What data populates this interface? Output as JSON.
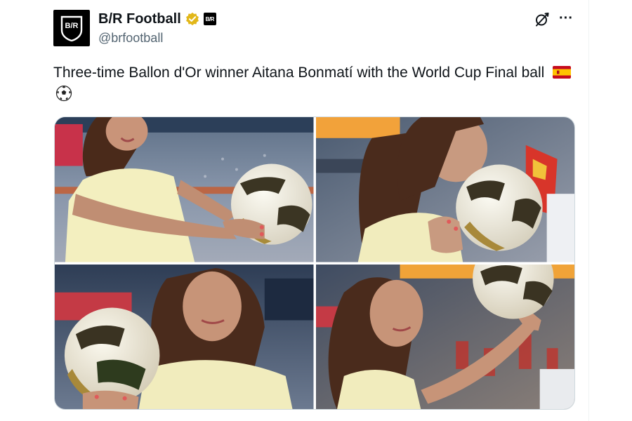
{
  "author": {
    "display_name": "B/R Football",
    "handle": "@brfootball",
    "avatar_label": "B/R",
    "affiliate_badge_label": "B/R",
    "verified_color": "#e2b719"
  },
  "tweet": {
    "text": "Three-time Ballon d'Or winner Aitana Bonmatí with the World Cup Final ball",
    "emojis": [
      "spain-flag",
      "soccer-ball"
    ]
  },
  "media": {
    "photos": [
      {
        "description_icon": "photo"
      },
      {
        "description_icon": "photo"
      },
      {
        "description_icon": "photo"
      },
      {
        "description_icon": "photo"
      }
    ]
  },
  "icons": {
    "grok": "grok-icon",
    "more": "more-icon"
  },
  "colors": {
    "text": "#0f1419",
    "secondary": "#536471",
    "border": "#cfd9de"
  }
}
